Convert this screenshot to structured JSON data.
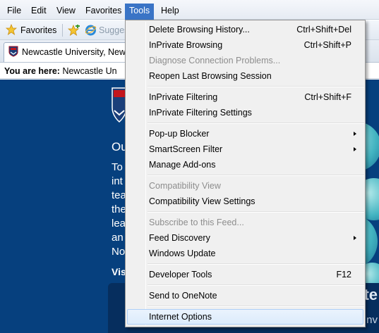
{
  "menubar": {
    "items": [
      {
        "label": "File"
      },
      {
        "label": "Edit"
      },
      {
        "label": "View"
      },
      {
        "label": "Favorites"
      },
      {
        "label": "Tools"
      },
      {
        "label": "Help"
      }
    ]
  },
  "favbar": {
    "favorites_label": "Favorites",
    "suggested_label": "Sugges"
  },
  "tab": {
    "title": "Newcastle University, Newc"
  },
  "breadcrumb": {
    "prefix": "You are here:",
    "path": "Newcastle Un"
  },
  "page": {
    "heading": "Ou",
    "lines": [
      "To",
      "int",
      "tea",
      "the",
      "lea",
      "an",
      "No"
    ],
    "visit": "Visi",
    "panel_title": "nte",
    "panel_sub": "University's Inv"
  },
  "tools_menu": {
    "items": [
      {
        "label": "Delete Browsing History...",
        "shortcut": "Ctrl+Shift+Del",
        "enabled": true
      },
      {
        "label": "InPrivate Browsing",
        "shortcut": "Ctrl+Shift+P",
        "enabled": true
      },
      {
        "label": "Diagnose Connection Problems...",
        "shortcut": "",
        "enabled": false
      },
      {
        "label": "Reopen Last Browsing Session",
        "shortcut": "",
        "enabled": true
      },
      {
        "label": "InPrivate Filtering",
        "shortcut": "Ctrl+Shift+F",
        "enabled": true
      },
      {
        "label": "InPrivate Filtering Settings",
        "shortcut": "",
        "enabled": true
      },
      {
        "label": "Pop-up Blocker",
        "shortcut": "",
        "enabled": true,
        "submenu": true
      },
      {
        "label": "SmartScreen Filter",
        "shortcut": "",
        "enabled": true,
        "submenu": true
      },
      {
        "label": "Manage Add-ons",
        "shortcut": "",
        "enabled": true
      },
      {
        "label": "Compatibility View",
        "shortcut": "",
        "enabled": false
      },
      {
        "label": "Compatibility View Settings",
        "shortcut": "",
        "enabled": true
      },
      {
        "label": "Subscribe to this Feed...",
        "shortcut": "",
        "enabled": false
      },
      {
        "label": "Feed Discovery",
        "shortcut": "",
        "enabled": true,
        "submenu": true
      },
      {
        "label": "Windows Update",
        "shortcut": "",
        "enabled": true
      },
      {
        "label": "Developer Tools",
        "shortcut": "F12",
        "enabled": true
      },
      {
        "label": "Send to OneNote",
        "shortcut": "",
        "enabled": true
      },
      {
        "label": "Internet Options",
        "shortcut": "",
        "enabled": true,
        "highlighted": true
      }
    ]
  },
  "colors": {
    "menu_active": "#3a74c6",
    "page_background": "#06407e",
    "disabled_text": "#8d8d8d"
  }
}
